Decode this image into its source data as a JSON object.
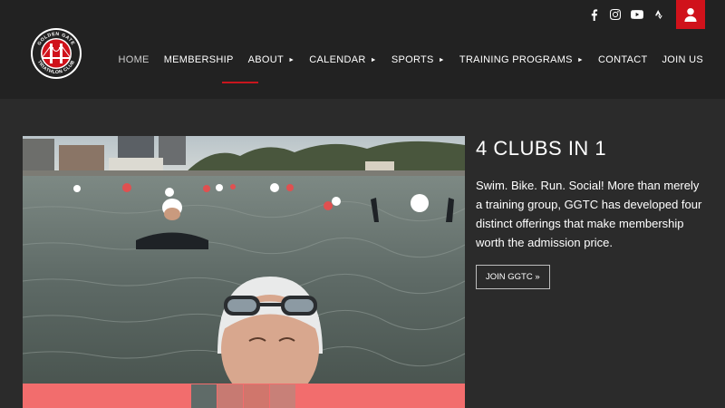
{
  "header": {
    "logo_text_top": "GOLDEN GATE",
    "logo_text_bottom": "TRIATHLON CLUB",
    "social_icons": [
      "facebook-icon",
      "instagram-icon",
      "youtube-icon",
      "strava-icon",
      "user-icon"
    ]
  },
  "nav": {
    "items": [
      {
        "label": "HOME",
        "has_submenu": false,
        "active": true
      },
      {
        "label": "MEMBERSHIP",
        "has_submenu": false
      },
      {
        "label": "ABOUT",
        "has_submenu": true
      },
      {
        "label": "CALENDAR",
        "has_submenu": true
      },
      {
        "label": "SPORTS",
        "has_submenu": true
      },
      {
        "label": "TRAINING PROGRAMS",
        "has_submenu": true
      },
      {
        "label": "CONTACT",
        "has_submenu": false
      },
      {
        "label": "JOIN US",
        "has_submenu": false
      }
    ],
    "caret": "►"
  },
  "hero": {
    "title": "4 CLUBS IN 1",
    "body": "Swim. Bike. Run. Social! More than merely a training group, GGTC has developed four distinct offerings that make membership worth the admission price.",
    "button_label": "JOIN GGTC »"
  },
  "colors": {
    "accent": "#d0121b",
    "header_bg": "#222222",
    "page_bg": "#2b2b2b",
    "thumbbar_bg": "#f26d6d"
  }
}
